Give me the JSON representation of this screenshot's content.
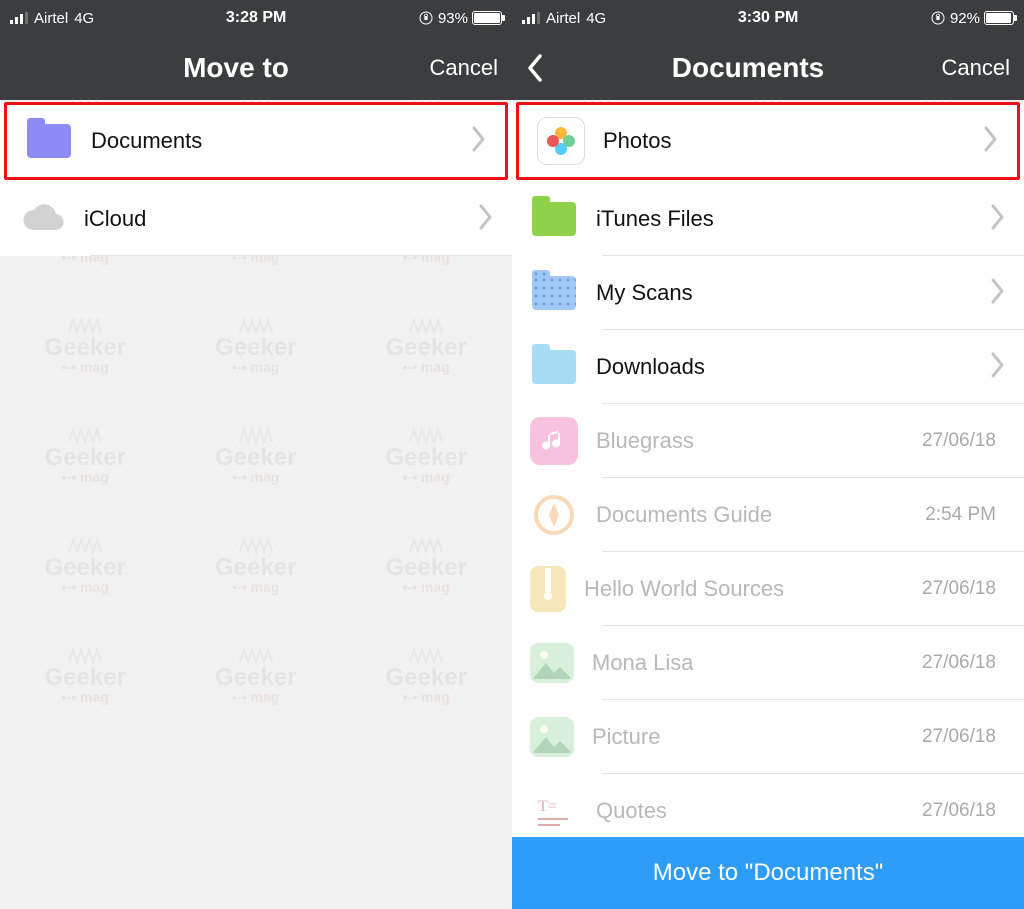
{
  "watermark": "Geeker",
  "watermark_sub": "mag",
  "left": {
    "status": {
      "carrier": "Airtel",
      "network": "4G",
      "time": "3:28 PM",
      "battery_pct": "93%"
    },
    "nav": {
      "title": "Move to",
      "cancel": "Cancel",
      "has_back": false
    },
    "rows": [
      {
        "label": "Documents",
        "icon": "folder-purple",
        "chevron": true,
        "highlighted": true
      },
      {
        "label": "iCloud",
        "icon": "cloud",
        "chevron": true
      }
    ]
  },
  "right": {
    "status": {
      "carrier": "Airtel",
      "network": "4G",
      "time": "3:30 PM",
      "battery_pct": "92%"
    },
    "nav": {
      "title": "Documents",
      "cancel": "Cancel",
      "has_back": true
    },
    "rows": [
      {
        "label": "Photos",
        "icon": "photos",
        "chevron": true,
        "highlighted": true
      },
      {
        "label": "iTunes Files",
        "icon": "folder-green",
        "chevron": true
      },
      {
        "label": "My Scans",
        "icon": "folder-blue-dotted",
        "chevron": true
      },
      {
        "label": "Downloads",
        "icon": "folder-lightblue",
        "chevron": true
      },
      {
        "label": "Bluegrass",
        "icon": "music-pink",
        "meta": "27/06/18",
        "dim": true
      },
      {
        "label": "Documents Guide",
        "icon": "compass",
        "meta": "2:54 PM",
        "dim": true
      },
      {
        "label": "Hello World Sources",
        "icon": "zip-yellow",
        "meta": "27/06/18",
        "dim": true
      },
      {
        "label": "Mona Lisa",
        "icon": "image",
        "meta": "27/06/18",
        "dim": true
      },
      {
        "label": "Picture",
        "icon": "image",
        "meta": "27/06/18",
        "dim": true
      },
      {
        "label": "Quotes",
        "icon": "text",
        "meta": "27/06/18",
        "dim": true
      }
    ],
    "action": "Move to \"Documents\""
  },
  "icon_colors": {
    "folder-purple": "#8d8cf7",
    "folder-green": "#8fd24a",
    "folder-blue-dotted": "#9fc8f5",
    "folder-lightblue": "#a7dcf5",
    "music-pink": "#f59acb",
    "zip-yellow": "#f3da8e",
    "image": "#bfe6c4",
    "compass": "#f2c08a",
    "text": "#e9c8c8",
    "cloud": "#d2d2d2"
  }
}
